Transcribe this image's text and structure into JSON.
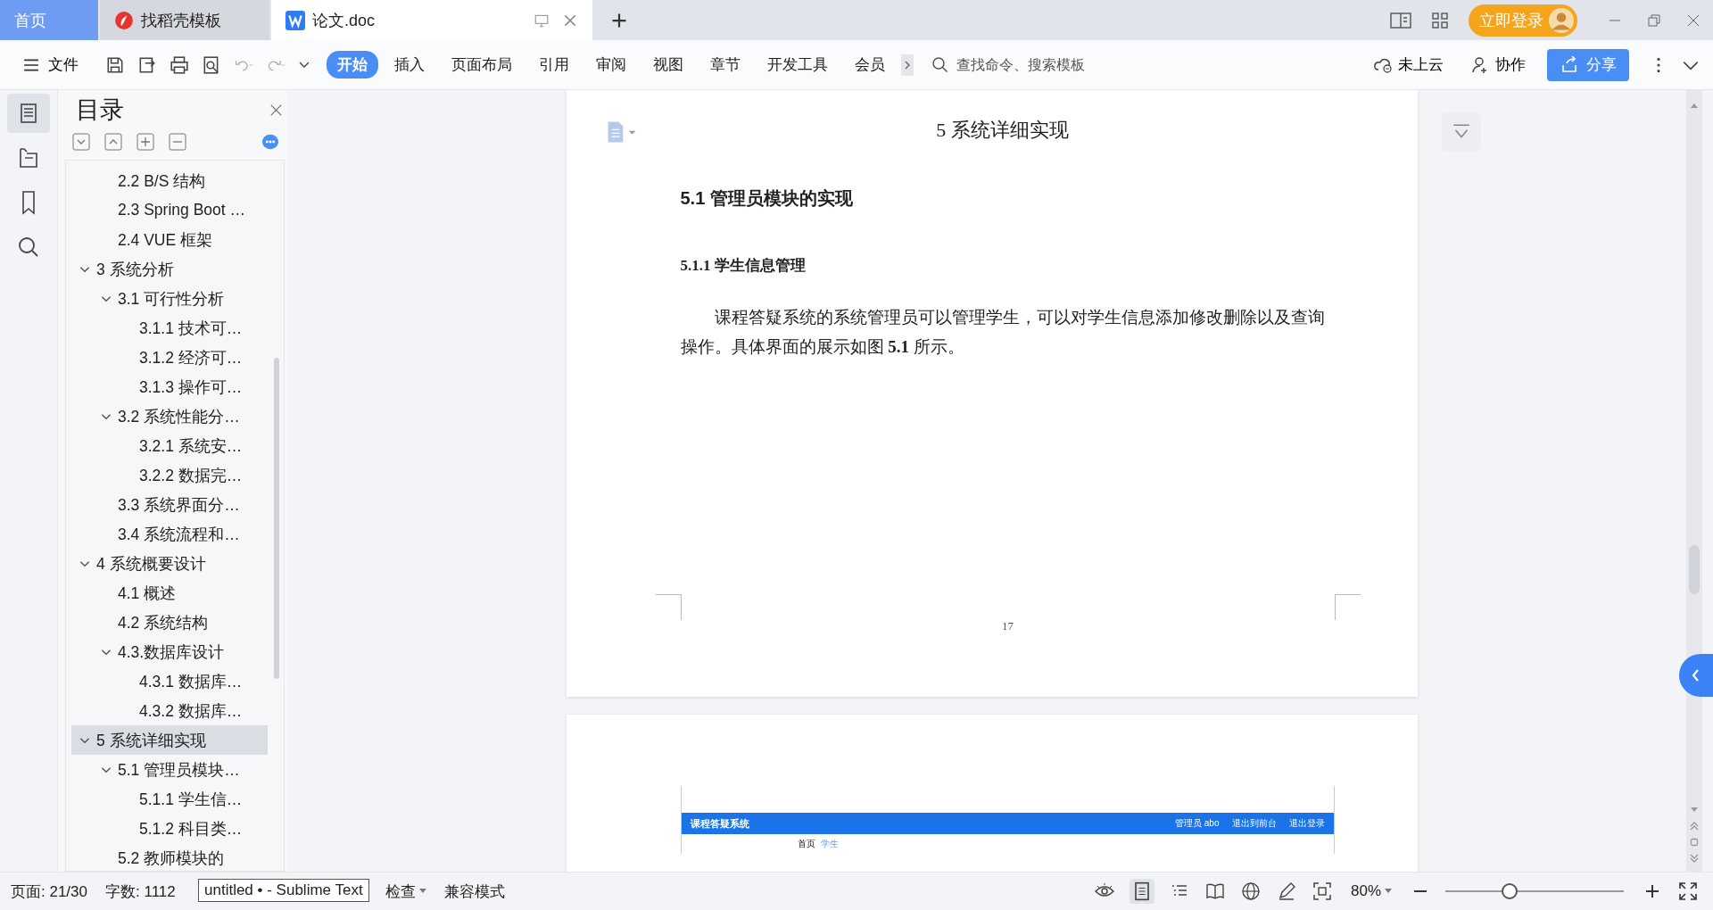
{
  "tabs": [
    {
      "label": "首页",
      "kind": "home",
      "selected": false
    },
    {
      "label": "找稻壳模板",
      "kind": "template",
      "selected": false
    },
    {
      "label": "论文.doc",
      "kind": "doc",
      "selected": true
    }
  ],
  "login_button": "立即登录",
  "toolbar": {
    "file_menu": "文件",
    "ribbon_tabs": [
      {
        "label": "开始",
        "selected": true
      },
      {
        "label": "插入",
        "selected": false
      },
      {
        "label": "页面布局",
        "selected": false
      },
      {
        "label": "引用",
        "selected": false
      },
      {
        "label": "审阅",
        "selected": false
      },
      {
        "label": "视图",
        "selected": false
      },
      {
        "label": "章节",
        "selected": false
      },
      {
        "label": "开发工具",
        "selected": false
      },
      {
        "label": "会员",
        "selected": false
      }
    ],
    "search": {
      "placeholder": "查找命令、搜索模板"
    },
    "cloud": "未上云",
    "collab": "协作",
    "share": "分享"
  },
  "toc": {
    "title": "目录",
    "items": [
      {
        "children": [
          {
            "label": "2.2 B/S 结构"
          },
          {
            "label": "2.3 Spring Boot …"
          },
          {
            "label": "2.4 VUE 框架"
          }
        ]
      },
      {
        "label": "3 系统分析",
        "expanded": true,
        "selected": false,
        "children": [
          {
            "label": "3.1 可行性分析",
            "expanded": true,
            "children": [
              {
                "label": "3.1.1 技术可…"
              },
              {
                "label": "3.1.2 经济可…"
              },
              {
                "label": "3.1.3 操作可…"
              }
            ]
          },
          {
            "label": "3.2 系统性能分…",
            "expanded": true,
            "children": [
              {
                "label": "3.2.1  系统安…"
              },
              {
                "label": "3.2.2  数据完…"
              }
            ]
          },
          {
            "label": "3.3 系统界面分…"
          },
          {
            "label": "3.4 系统流程和…"
          }
        ]
      },
      {
        "label": "4 系统概要设计",
        "expanded": true,
        "selected": false,
        "children": [
          {
            "label": "4.1 概述"
          },
          {
            "label": "4.2 系统结构"
          },
          {
            "label": "4.3.数据库设计",
            "expanded": true,
            "children": [
              {
                "label": "4.3.1 数据库…"
              },
              {
                "label": "4.3.2 数据库…"
              }
            ]
          }
        ]
      },
      {
        "label": "5 系统详细实现",
        "expanded": true,
        "selected": true,
        "children": [
          {
            "label": "5.1  管理员模块…",
            "expanded": true,
            "children": [
              {
                "label": "5.1.1  学生信…"
              },
              {
                "label": "5.1.2  科目类…"
              }
            ]
          },
          {
            "label": "5.2  教师模块的"
          }
        ]
      }
    ]
  },
  "document": {
    "chapter_title": "5 系统详细实现",
    "section_title": "5.1  管理员模块的实现",
    "subsection_title": "5.1.1  学生信息管理",
    "paragraph": "课程答疑系统的系统管理员可以管理学生，可以对学生信息添加修改删除以及查询操作。具体界面的展示如图 **5.1** 所示。",
    "page_number": "17",
    "figure": {
      "app_title": "课程答疑系统",
      "header_links": [
        "管理员 abo",
        "退出到前台",
        "退出登录"
      ],
      "breadcrumb": [
        "首页",
        "学生"
      ]
    }
  },
  "status_bar": {
    "page": "页面: 21/30",
    "words": "字数: 1112",
    "spell_check": "检查",
    "mode": "兼容模式",
    "zoom": "80%",
    "zoom_slider": {
      "level": 0.36
    }
  },
  "tooltip": "untitled • - Sublime Text"
}
